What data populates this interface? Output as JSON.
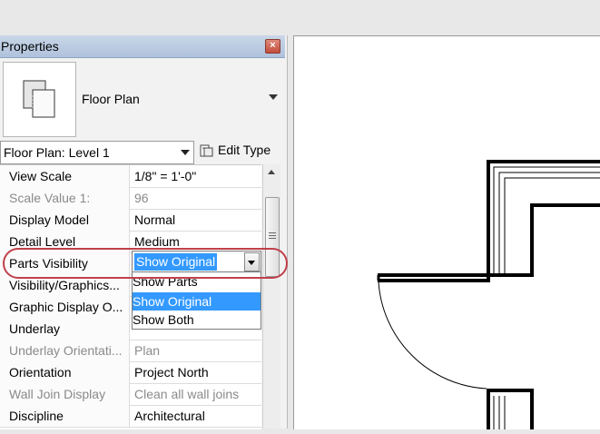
{
  "panel": {
    "title": "Properties",
    "close_glyph": "×",
    "type_selector": {
      "name": "Floor Plan",
      "icon": "floor-plan-icon"
    },
    "instance_selector": {
      "value": "Floor Plan: Level 1"
    },
    "edit_type_label": "Edit Type"
  },
  "properties": [
    {
      "name": "View Scale",
      "value": "1/8\" = 1'-0\"",
      "dimmed": false
    },
    {
      "name": "Scale Value    1:",
      "value": "96",
      "dimmed": true
    },
    {
      "name": "Display Model",
      "value": "Normal",
      "dimmed": false
    },
    {
      "name": "Detail Level",
      "value": "Medium",
      "dimmed": false
    },
    {
      "name": "Parts Visibility",
      "value": "",
      "dimmed": false
    },
    {
      "name": "Visibility/Graphics...",
      "value": "",
      "dimmed": false
    },
    {
      "name": "Graphic Display O...",
      "value": "",
      "dimmed": false
    },
    {
      "name": "Underlay",
      "value": "",
      "dimmed": false
    },
    {
      "name": "Underlay Orientati...",
      "value": "Plan",
      "dimmed": true
    },
    {
      "name": "Orientation",
      "value": "Project North",
      "dimmed": false
    },
    {
      "name": "Wall Join Display",
      "value": "Clean all wall joins",
      "dimmed": true
    },
    {
      "name": "Discipline",
      "value": "Architectural",
      "dimmed": false
    }
  ],
  "parts_visibility": {
    "selected": "Show Original",
    "options": [
      "Show Parts",
      "Show Original",
      "Show Both"
    ],
    "highlighted_index": 1
  },
  "colors": {
    "highlight": "#3399ff",
    "callout": "#c0404a"
  }
}
